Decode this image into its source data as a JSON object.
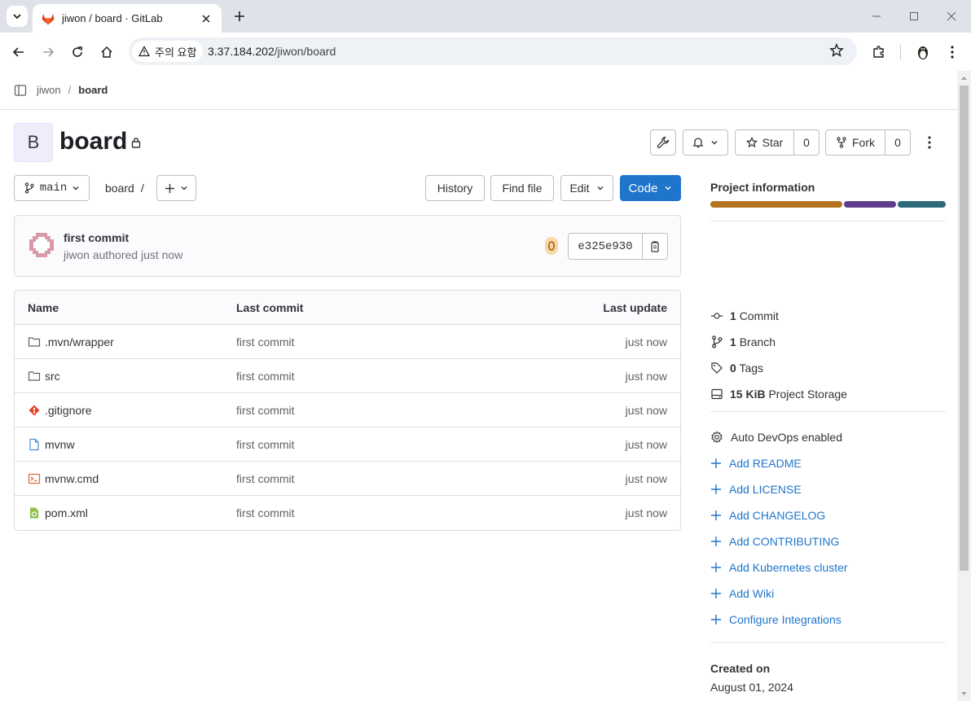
{
  "browser": {
    "tab_title": "jiwon / board · GitLab",
    "security_label": "주의 요함",
    "url_host": "3.37.184.202",
    "url_path": "/jiwon/board"
  },
  "breadcrumb": {
    "group": "jiwon",
    "separator": "/",
    "project": "board"
  },
  "project": {
    "avatar_letter": "B",
    "name": "board",
    "star_label": "Star",
    "star_count": "0",
    "fork_label": "Fork",
    "fork_count": "0"
  },
  "repo_bar": {
    "branch": "main",
    "path_root": "board",
    "path_sep": "/",
    "history_label": "History",
    "find_file_label": "Find file",
    "edit_label": "Edit",
    "code_label": "Code"
  },
  "last_commit": {
    "title": "first commit",
    "author": "jiwon",
    "authored_text": "authored",
    "time": "just now",
    "sha": "e325e930"
  },
  "file_table": {
    "headers": {
      "name": "Name",
      "last_commit": "Last commit",
      "last_update": "Last update"
    },
    "rows": [
      {
        "name": ".mvn/wrapper",
        "icon": "folder-icon",
        "commit": "first commit",
        "updated": "just now"
      },
      {
        "name": "src",
        "icon": "folder-icon",
        "commit": "first commit",
        "updated": "just now"
      },
      {
        "name": ".gitignore",
        "icon": "git-icon",
        "commit": "first commit",
        "updated": "just now"
      },
      {
        "name": "mvnw",
        "icon": "file-icon",
        "commit": "first commit",
        "updated": "just now"
      },
      {
        "name": "mvnw.cmd",
        "icon": "terminal-file-icon",
        "commit": "first commit",
        "updated": "just now"
      },
      {
        "name": "pom.xml",
        "icon": "xml-file-icon",
        "commit": "first commit",
        "updated": "just now"
      }
    ]
  },
  "sidebar": {
    "heading": "Project information",
    "language_colors": [
      "#b57320",
      "#5f3d8b",
      "#2f6a7a"
    ],
    "stats": [
      {
        "count": "1",
        "label": "Commit"
      },
      {
        "count": "1",
        "label": "Branch"
      },
      {
        "count": "0",
        "label": "Tags"
      },
      {
        "count": "15 KiB",
        "label": "Project Storage"
      }
    ],
    "auto_devops": "Auto DevOps enabled",
    "links": [
      "Add README",
      "Add LICENSE",
      "Add CHANGELOG",
      "Add CONTRIBUTING",
      "Add Kubernetes cluster",
      "Add Wiki",
      "Configure Integrations"
    ],
    "created_label": "Created on",
    "created_date": "August 01, 2024"
  }
}
